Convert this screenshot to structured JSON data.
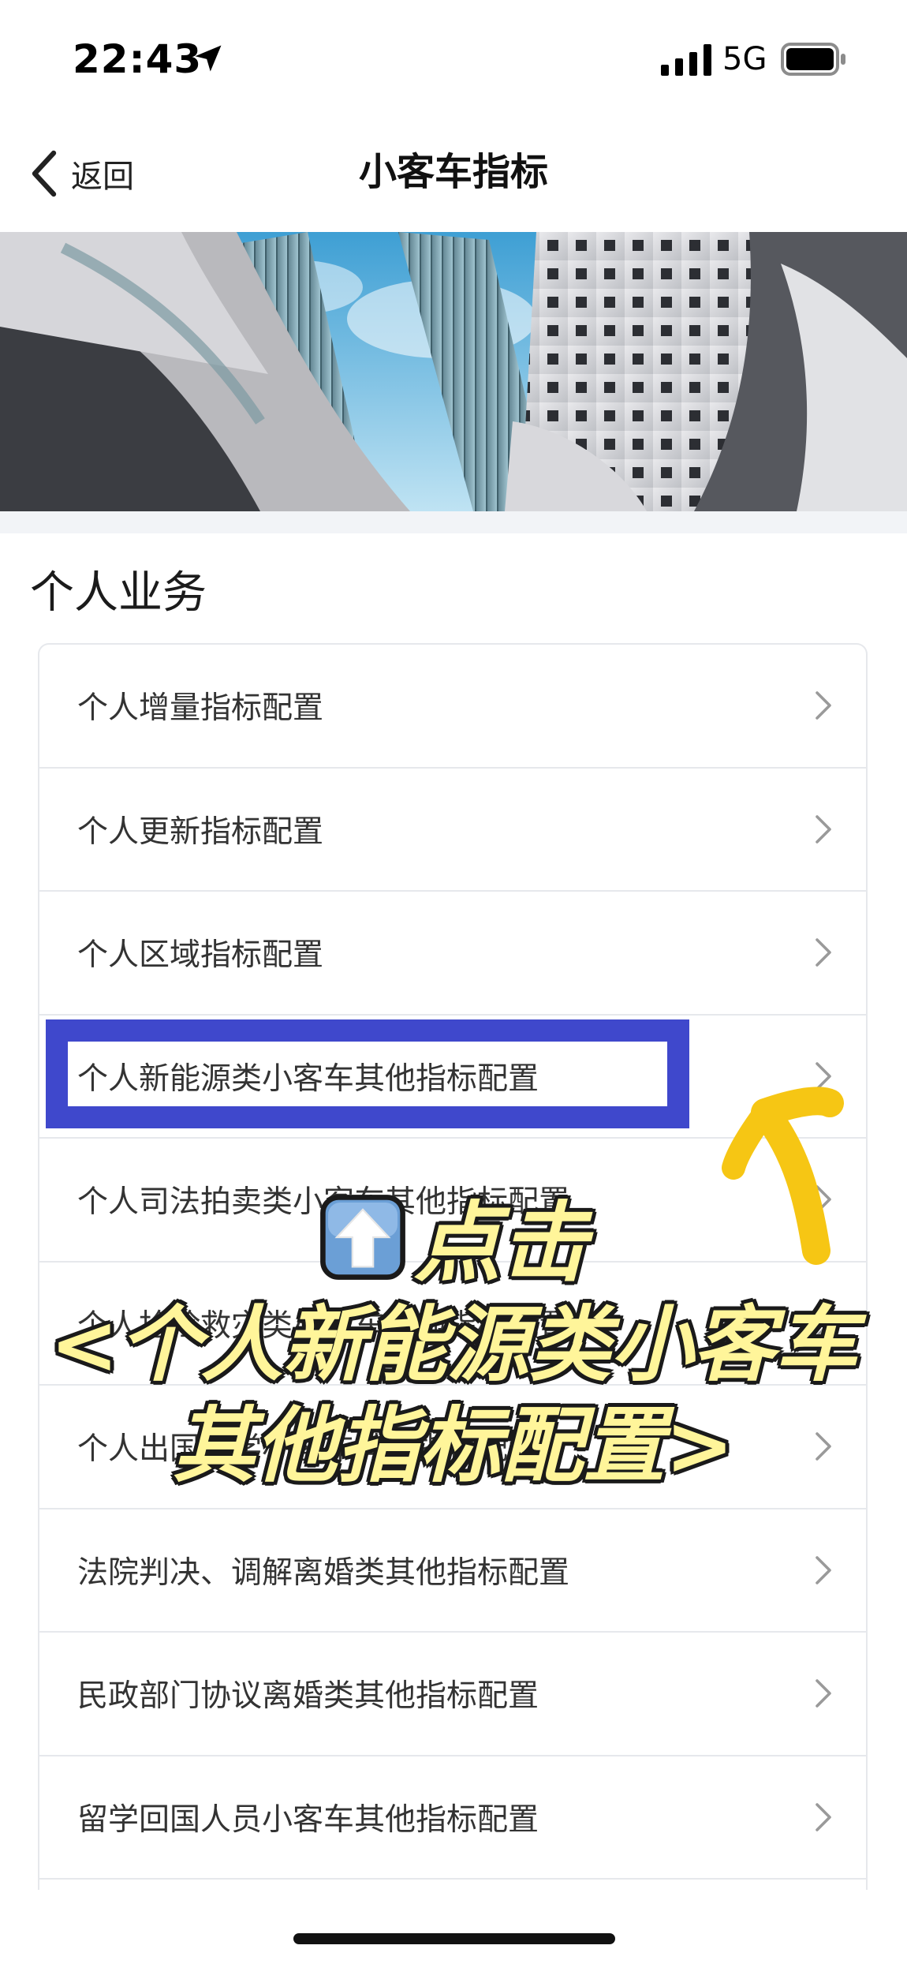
{
  "status_bar": {
    "time": "22:43",
    "network": "5G",
    "icons": [
      "location-arrow-icon",
      "signal-icon",
      "battery-icon"
    ]
  },
  "nav": {
    "back_label": "返回",
    "title": "小客车指标",
    "back_icon": "chevron-left-icon"
  },
  "section": {
    "title": "个人业务"
  },
  "list": {
    "chevron_icon": "chevron-right-icon",
    "items": [
      {
        "label": "个人增量指标配置"
      },
      {
        "label": "个人更新指标配置"
      },
      {
        "label": "个人区域指标配置"
      },
      {
        "label": "个人新能源类小客车其他指标配置"
      },
      {
        "label": "个人司法拍卖类小客车其他指标配置"
      },
      {
        "label": "个人抢险救灾类小客车其他指标配置"
      },
      {
        "label": "个人出国留学小客车其他指标配置"
      },
      {
        "label": "法院判决、调解离婚类其他指标配置"
      },
      {
        "label": "民政部门协议离婚类其他指标配置"
      },
      {
        "label": "留学回国人员小客车其他指标配置"
      }
    ]
  },
  "overlay": {
    "line1": "点击",
    "line2": "<个人新能源类小客车",
    "line3": "其他指标配置>",
    "emoji_icon": "up-arrow-emoji-icon",
    "caption_color": "#fff59a",
    "highlight_color": "#3f48cc",
    "pointer_color": "#f6c614"
  }
}
